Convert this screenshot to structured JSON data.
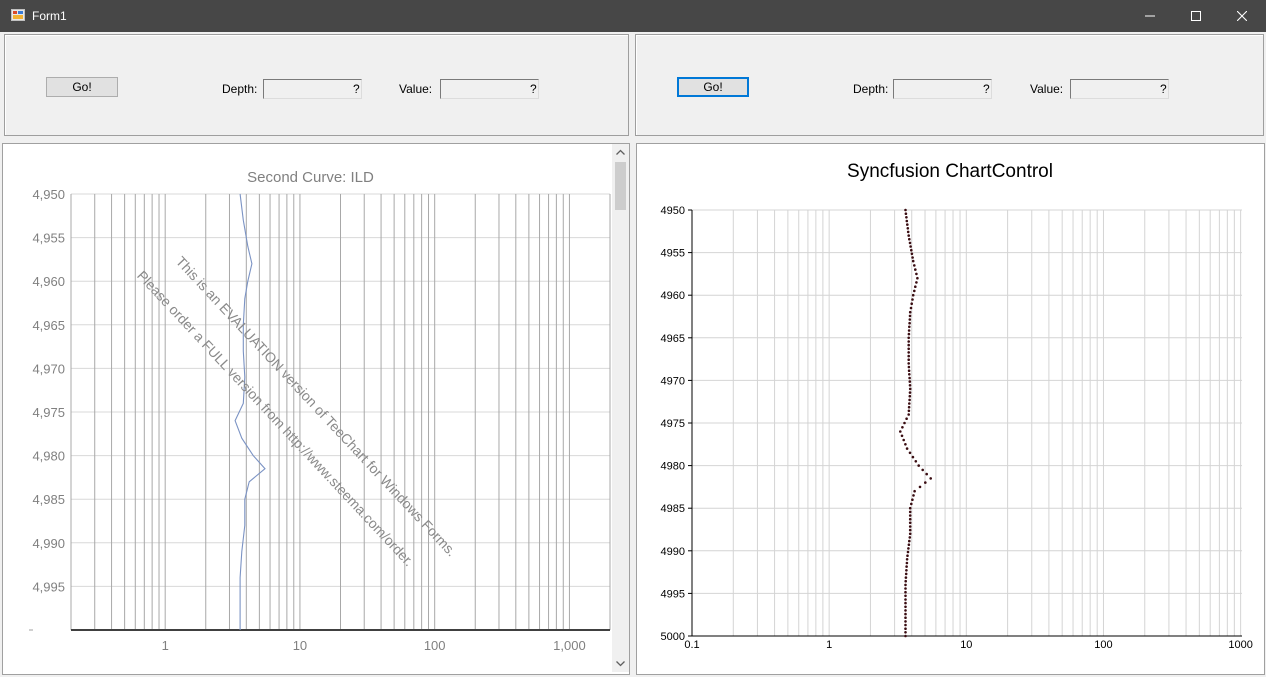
{
  "window": {
    "title": "Form1"
  },
  "left_panel": {
    "go_label": "Go!",
    "depth_label": "Depth:",
    "depth_value": "?",
    "value_label": "Value:",
    "value_value": "?"
  },
  "right_panel": {
    "go_label": "Go!",
    "depth_label": "Depth:",
    "depth_value": "?",
    "value_label": "Value:",
    "value_value": "?"
  },
  "chart_data": [
    {
      "type": "line",
      "title": "Second Curve: ILD",
      "x_scale": "log",
      "xlim": [
        0.2,
        2000
      ],
      "x_ticks": [
        "1",
        "10",
        "100",
        "1,000"
      ],
      "ylim": [
        4950,
        5000
      ],
      "y_ticks": [
        "4,950",
        "4,955",
        "4,960",
        "4,965",
        "4,970",
        "4,975",
        "4,980",
        "4,985",
        "4,990",
        "4,995"
      ],
      "y_inverted": true,
      "grid": true,
      "series_color": "#7b93c4",
      "watermark": [
        "This is an EVALUATION version of TeeChart for Windows Forms.",
        "Please order a FULL version from http://www.steema.com/order."
      ],
      "points": [
        {
          "depth": 4950,
          "value": 3.6
        },
        {
          "depth": 4953,
          "value": 3.8
        },
        {
          "depth": 4956,
          "value": 4.1
        },
        {
          "depth": 4958,
          "value": 4.4
        },
        {
          "depth": 4960,
          "value": 4.1
        },
        {
          "depth": 4962,
          "value": 3.9
        },
        {
          "depth": 4965,
          "value": 3.8
        },
        {
          "depth": 4968,
          "value": 3.8
        },
        {
          "depth": 4971,
          "value": 3.9
        },
        {
          "depth": 4974,
          "value": 3.8
        },
        {
          "depth": 4976,
          "value": 3.3
        },
        {
          "depth": 4978,
          "value": 3.7
        },
        {
          "depth": 4980,
          "value": 4.5
        },
        {
          "depth": 4981.5,
          "value": 5.5
        },
        {
          "depth": 4983,
          "value": 4.2
        },
        {
          "depth": 4985,
          "value": 3.9
        },
        {
          "depth": 4988,
          "value": 3.9
        },
        {
          "depth": 4991,
          "value": 3.7
        },
        {
          "depth": 4994,
          "value": 3.6
        },
        {
          "depth": 4997,
          "value": 3.6
        },
        {
          "depth": 5000,
          "value": 3.6
        }
      ]
    },
    {
      "type": "scatter",
      "title": "Syncfusion ChartControl",
      "x_scale": "log",
      "xlim": [
        0.1,
        1000
      ],
      "x_ticks": [
        "0.1",
        "1",
        "10",
        "100",
        "1000",
        "1000"
      ],
      "ylim": [
        4950,
        5000
      ],
      "y_ticks": [
        "4950",
        "4955",
        "4960",
        "4965",
        "4970",
        "4975",
        "4980",
        "4985",
        "4990",
        "4995",
        "5000"
      ],
      "y_inverted": true,
      "grid": true,
      "series_color": "#3a0d12",
      "points": [
        {
          "depth": 4950,
          "value": 3.6
        },
        {
          "depth": 4953,
          "value": 3.8
        },
        {
          "depth": 4956,
          "value": 4.1
        },
        {
          "depth": 4958,
          "value": 4.4
        },
        {
          "depth": 4960,
          "value": 4.1
        },
        {
          "depth": 4962,
          "value": 3.9
        },
        {
          "depth": 4965,
          "value": 3.8
        },
        {
          "depth": 4968,
          "value": 3.8
        },
        {
          "depth": 4971,
          "value": 3.9
        },
        {
          "depth": 4974,
          "value": 3.8
        },
        {
          "depth": 4976,
          "value": 3.3
        },
        {
          "depth": 4978,
          "value": 3.7
        },
        {
          "depth": 4980,
          "value": 4.5
        },
        {
          "depth": 4981.5,
          "value": 5.5
        },
        {
          "depth": 4983,
          "value": 4.2
        },
        {
          "depth": 4985,
          "value": 3.9
        },
        {
          "depth": 4988,
          "value": 3.9
        },
        {
          "depth": 4991,
          "value": 3.7
        },
        {
          "depth": 4994,
          "value": 3.6
        },
        {
          "depth": 4997,
          "value": 3.6
        },
        {
          "depth": 5000,
          "value": 3.6
        }
      ]
    }
  ]
}
